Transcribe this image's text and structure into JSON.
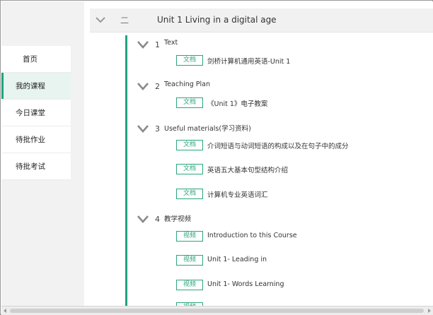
{
  "sidebar": {
    "items": [
      {
        "label": "首页"
      },
      {
        "label": "我的课程"
      },
      {
        "label": "今日课堂"
      },
      {
        "label": "待批作业"
      },
      {
        "label": "待批考试"
      }
    ]
  },
  "unit": {
    "seq": "二",
    "title": "Unit 1 Living in a digital age"
  },
  "sections": [
    {
      "num": "1",
      "title": "Text",
      "items": [
        {
          "badge": "文档",
          "title": "剑桥计算机通用英语-Unit 1"
        }
      ]
    },
    {
      "num": "2",
      "title": "Teaching Plan",
      "items": [
        {
          "badge": "文档",
          "title": "《Unit 1》电子教案"
        }
      ]
    },
    {
      "num": "3",
      "title": "Useful materials(学习资料)",
      "items": [
        {
          "badge": "文档",
          "title": "介词短语与动词短语的构成以及在句子中的成分"
        },
        {
          "badge": "文档",
          "title": "英语五大基本句型结构介绍"
        },
        {
          "badge": "文档",
          "title": "计算机专业英语词汇"
        }
      ]
    },
    {
      "num": "4",
      "title": "教学视频",
      "items": [
        {
          "badge": "视频",
          "title": "Introduction to this Course"
        },
        {
          "badge": "视频",
          "title": "Unit 1- Leading in"
        },
        {
          "badge": "视频",
          "title": "Unit 1- Words Learning"
        },
        {
          "badge": "视频",
          "title": ""
        }
      ]
    }
  ],
  "colors": {
    "accent": "#23a27f",
    "badge": "#2ba57d",
    "active_bg": "#e7f4ef"
  }
}
